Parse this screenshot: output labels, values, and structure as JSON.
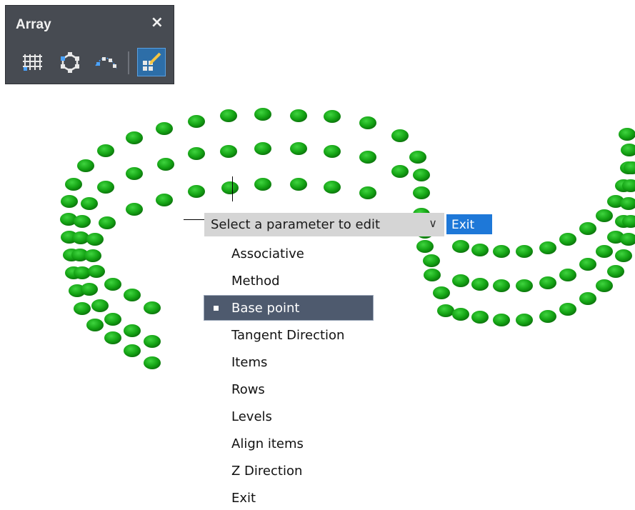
{
  "toolbar": {
    "title": "Array",
    "close_glyph": "×",
    "tools": [
      {
        "name": "rectangular-array-icon"
      },
      {
        "name": "polar-array-icon"
      },
      {
        "name": "path-array-icon"
      },
      {
        "name": "edit-array-icon"
      }
    ]
  },
  "prompt": {
    "label": "Select a parameter to edit",
    "dropdown_glyph": "∨",
    "exit_label": "Exit"
  },
  "menu": {
    "items": [
      {
        "label": "Associative",
        "selected": false
      },
      {
        "label": "Method",
        "selected": false
      },
      {
        "label": "Base point",
        "selected": true
      },
      {
        "label": "Tangent Direction",
        "selected": false
      },
      {
        "label": "Items",
        "selected": false
      },
      {
        "label": "Rows",
        "selected": false
      },
      {
        "label": "Levels",
        "selected": false
      },
      {
        "label": "Align items",
        "selected": false
      },
      {
        "label": "Z Direction",
        "selected": false
      },
      {
        "label": "Exit",
        "selected": false
      }
    ]
  },
  "colors": {
    "dot": "#14a314",
    "dot_dark": "#0b6d0b",
    "panel": "#474b52",
    "selected_item": "#4e5a6e",
    "exit_button": "#1e78d8"
  }
}
